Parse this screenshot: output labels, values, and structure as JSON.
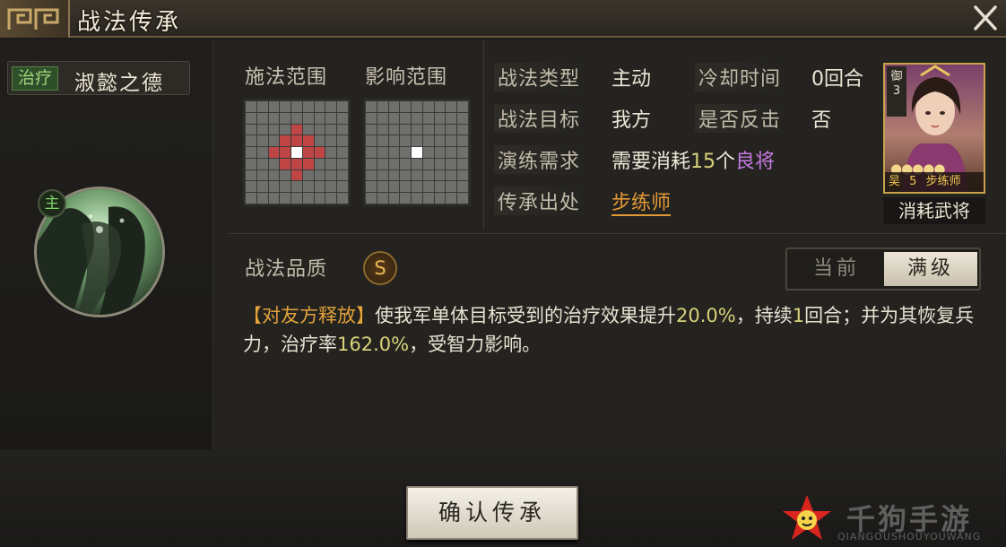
{
  "window": {
    "title": "战法传承"
  },
  "skill": {
    "type_badge": "治疗",
    "name": "淑懿之德",
    "main_badge": "主"
  },
  "ranges": {
    "cast_label": "施法范围",
    "effect_label": "影响范围",
    "cast_grid": [
      "000000000",
      "000000000",
      "000010000",
      "000111000",
      "001121100",
      "000111000",
      "000010000",
      "000000000",
      "000000000"
    ],
    "effect_grid": [
      "000000000",
      "000000000",
      "000000000",
      "000000000",
      "000020000",
      "000000000",
      "000000000",
      "000000000",
      "000000000"
    ]
  },
  "info": {
    "type_key": "战法类型",
    "type_val": "主动",
    "cooldown_key": "冷却时间",
    "cooldown_val": "0回合",
    "target_key": "战法目标",
    "target_val": "我方",
    "counter_key": "是否反击",
    "counter_val": "否",
    "req_key": "演练需求",
    "req_prefix": "需要消耗",
    "req_num": "15",
    "req_unit": "个",
    "req_grade": "良将",
    "source_key": "传承出处",
    "source_val": "步练师"
  },
  "general_card": {
    "rank_label": "御",
    "rank_num": "3",
    "stars": "●●●●●",
    "faction": "吴",
    "level": "5",
    "name": "步练师",
    "caption": "消耗武将"
  },
  "quality": {
    "label": "战法品质",
    "grade": "S"
  },
  "level_toggle": {
    "current": "当前",
    "max": "满级"
  },
  "description": {
    "tag": "【对友方释放】",
    "p1": "使我军单体目标受到的治疗效果提升",
    "v1": "20.0%",
    "p2": "，持续",
    "v2": "1",
    "p3": "回合；并为其恢复兵力，治疗率",
    "v3": "162.0%",
    "p4": "，受智力影响。"
  },
  "actions": {
    "confirm": "确认传承"
  },
  "watermark": {
    "text": "千狗手游",
    "sub": "QIANGOUSHOUYOUWANG"
  },
  "colors": {
    "accent_orange": "#e39a36",
    "value_yellow": "#d8d27a",
    "heal_green": "#9fd07a",
    "grade_purple": "#c57ae0",
    "grid_red": "#c04646"
  }
}
